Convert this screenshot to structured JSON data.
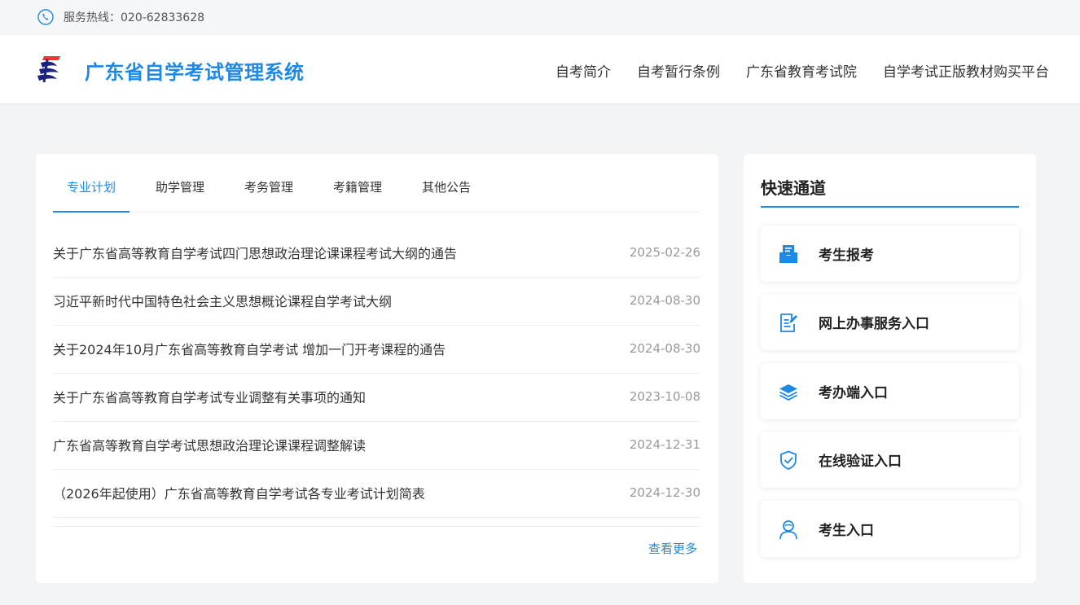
{
  "topbar": {
    "hotline": "服务热线：020-62833628"
  },
  "header": {
    "site_title": "广东省自学考试管理系统",
    "nav": [
      "自考简介",
      "自考暂行条例",
      "广东省教育考试院",
      "自学考试正版教材购买平台"
    ]
  },
  "news": {
    "tabs": [
      "专业计划",
      "助学管理",
      "考务管理",
      "考籍管理",
      "其他公告"
    ],
    "items": [
      {
        "title": "关于广东省高等教育自学考试四门思想政治理论课课程考试大纲的通告",
        "date": "2025-02-26"
      },
      {
        "title": "习近平新时代中国特色社会主义思想概论课程自学考试大纲",
        "date": "2024-08-30"
      },
      {
        "title": "关于2024年10月广东省高等教育自学考试 增加一门开考课程的通告",
        "date": "2024-08-30"
      },
      {
        "title": "关于广东省高等教育自学考试专业调整有关事项的通知",
        "date": "2023-10-08"
      },
      {
        "title": "广东省高等教育自学考试思想政治理论课课程调整解读",
        "date": "2024-12-31"
      },
      {
        "title": "（2026年起使用）广东省高等教育自学考试各专业考试计划简表",
        "date": "2024-12-30"
      }
    ],
    "more_label": "查看更多"
  },
  "quick": {
    "title": "快速通道",
    "items": [
      {
        "label": "考生报考",
        "icon": "mail-inbox-icon"
      },
      {
        "label": "网上办事服务入口",
        "icon": "document-edit-icon"
      },
      {
        "label": "考办端入口",
        "icon": "layers-icon"
      },
      {
        "label": "在线验证入口",
        "icon": "shield-check-icon"
      },
      {
        "label": "考生入口",
        "icon": "user-icon"
      }
    ]
  },
  "colors": {
    "accent": "#1e88e5",
    "background": "#f3f4f6"
  }
}
